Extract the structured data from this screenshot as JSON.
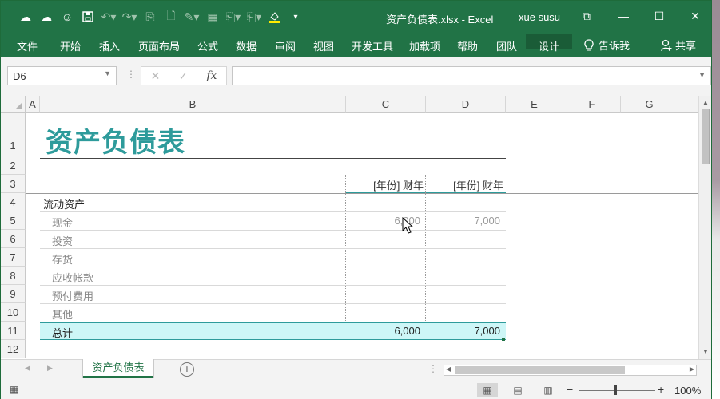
{
  "window": {
    "title": "资产负债表.xlsx  -  Excel",
    "user": "xue susu",
    "controls": [
      "⧉",
      "—",
      "☐",
      "✕"
    ]
  },
  "ribbon": {
    "tabs": [
      "文件",
      "开始",
      "插入",
      "页面布局",
      "公式",
      "数据",
      "审阅",
      "视图",
      "开发工具",
      "加载项",
      "帮助",
      "团队",
      "设计"
    ],
    "tell_me": "告诉我",
    "share": "共享"
  },
  "formula_bar": {
    "name_box": "D6",
    "cancel": "✕",
    "enter": "✓",
    "fx": "fx",
    "formula": ""
  },
  "columns": [
    "A",
    "B",
    "C",
    "D",
    "E",
    "F",
    "G"
  ],
  "rows": [
    "1",
    "2",
    "3",
    "4",
    "5",
    "6",
    "7",
    "8",
    "9",
    "10",
    "11",
    "12"
  ],
  "sheet": {
    "title": "资产负债表",
    "year_header_c": "[年份] 财年",
    "year_header_d": "[年份] 财年",
    "section": "流动资产",
    "items": [
      {
        "label": "现金",
        "c": "6,000",
        "d": "7,000"
      },
      {
        "label": "投资",
        "c": "",
        "d": ""
      },
      {
        "label": "存货",
        "c": "",
        "d": ""
      },
      {
        "label": "应收帐款",
        "c": "",
        "d": ""
      },
      {
        "label": "预付费用",
        "c": "",
        "d": ""
      },
      {
        "label": "其他",
        "c": "",
        "d": ""
      }
    ],
    "total": {
      "label": "总计",
      "c": "6,000",
      "d": "7,000"
    }
  },
  "sheet_tabs": [
    "资产负债表"
  ],
  "status": {
    "zoom": "100%",
    "zoom_out": "−",
    "zoom_in": "+"
  },
  "colors": {
    "excel_green": "#217346",
    "title_teal": "#2e9b9b",
    "total_fill": "#cdf6f7"
  }
}
